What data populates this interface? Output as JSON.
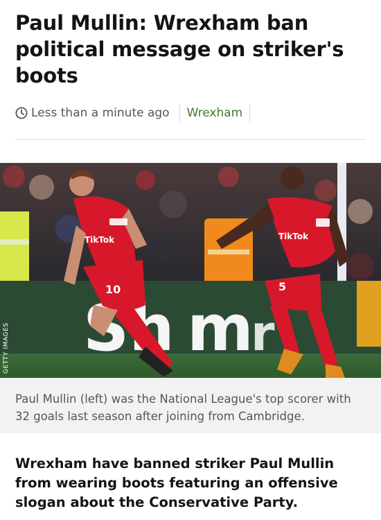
{
  "article": {
    "headline": "Paul Mullin: Wrexham ban political message on striker's boots",
    "timestamp": "Less than a minute ago",
    "topic": "Wrexham",
    "image": {
      "credit": "GETTY IMAGES",
      "caption": "Paul Mullin (left) was the National League's top scorer with 32 goals last season after joining from Cambridge.",
      "shirt_sponsor": "TikTok",
      "shirt_number_left": "10",
      "shirt_number_right": "5",
      "board_text": "Sh",
      "board_text_2": "m",
      "board_text_3": "r"
    },
    "lead": "Wrexham have banned striker Paul Mullin from wearing boots featuring an offensive slogan about the Conservative Party."
  },
  "icons": {
    "clock": "clock-icon"
  },
  "colors": {
    "topic_link": "#407a2a",
    "meta_text": "#545658",
    "kit_red": "#d7182a"
  }
}
